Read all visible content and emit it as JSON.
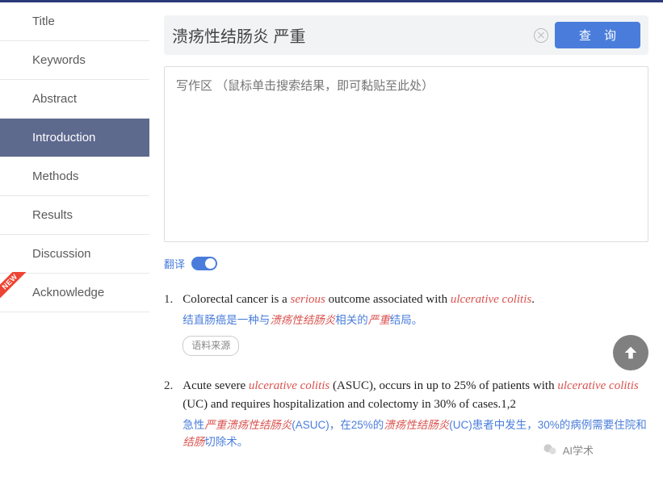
{
  "sidebar": {
    "items": [
      {
        "label": "Title"
      },
      {
        "label": "Keywords"
      },
      {
        "label": "Abstract"
      },
      {
        "label": "Introduction"
      },
      {
        "label": "Methods"
      },
      {
        "label": "Results"
      },
      {
        "label": "Discussion"
      },
      {
        "label": "Acknowledge"
      }
    ],
    "active_index": 3,
    "new_badge_index": 7
  },
  "search": {
    "value": "溃疡性结肠炎 严重",
    "query_button": "查 询"
  },
  "writing": {
    "placeholder": "写作区 （鼠标单击搜索结果，即可黏贴至此处）"
  },
  "translate": {
    "label": "翻译",
    "on": true
  },
  "source_tag_label": "语料来源",
  "results": [
    {
      "num": "1.",
      "en_parts": [
        {
          "t": "Colorectal cancer is a "
        },
        {
          "t": "serious",
          "hl": true
        },
        {
          "t": " outcome associated with "
        },
        {
          "t": "ulcerative colitis",
          "hl": true
        },
        {
          "t": "."
        }
      ],
      "cn_parts": [
        {
          "t": "结直肠癌是一种与"
        },
        {
          "t": "溃疡性结肠炎",
          "hl": true
        },
        {
          "t": "相关的"
        },
        {
          "t": "严重",
          "hl": true
        },
        {
          "t": "结局。"
        }
      ],
      "show_source": true
    },
    {
      "num": "2.",
      "en_parts": [
        {
          "t": "Acute severe "
        },
        {
          "t": "ulcerative colitis",
          "hl": true
        },
        {
          "t": " (ASUC), occurs in up to 25% of patients with "
        },
        {
          "t": "ulcerative colitis",
          "hl": true
        },
        {
          "t": " (UC) and requires hospitalization and colectomy in 30% of cases.1,2"
        }
      ],
      "cn_parts": [
        {
          "t": "急性"
        },
        {
          "t": "严重溃疡性结肠炎",
          "hl": true
        },
        {
          "t": "(ASUC)，在25%的"
        },
        {
          "t": "溃疡性结肠炎",
          "hl": true
        },
        {
          "t": "(UC)患者中发生，30%的病例需要住院和"
        },
        {
          "t": "结肠",
          "hl": true
        },
        {
          "t": "切除术。"
        }
      ],
      "show_source": false
    }
  ],
  "wechat": {
    "label": "AI学术"
  }
}
